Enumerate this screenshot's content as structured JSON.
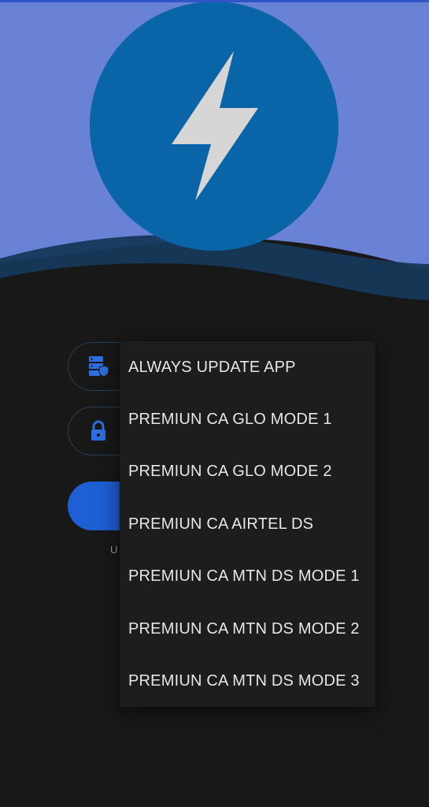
{
  "colors": {
    "sky": "#6a82d5",
    "logo_circle": "#0a65a8",
    "bolt": "#d6d6d6",
    "wave_dark": "#16385a",
    "background": "#181818",
    "accent": "#1e5fd4",
    "field_border": "#2a3f57"
  },
  "header": {
    "logo_icon": "lightning-bolt-icon"
  },
  "form": {
    "server_icon": "server-shield-icon",
    "password_icon": "lock-icon",
    "footer_text_visible": "U"
  },
  "menu": {
    "items": [
      "ALWAYS UPDATE APP",
      "PREMIUN CA GLO MODE 1",
      "PREMIUN CA GLO MODE 2",
      "PREMIUN CA AIRTEL DS",
      "PREMIUN CA MTN DS MODE 1",
      "PREMIUN CA MTN DS MODE 2",
      "PREMIUN CA MTN DS MODE 3"
    ]
  }
}
